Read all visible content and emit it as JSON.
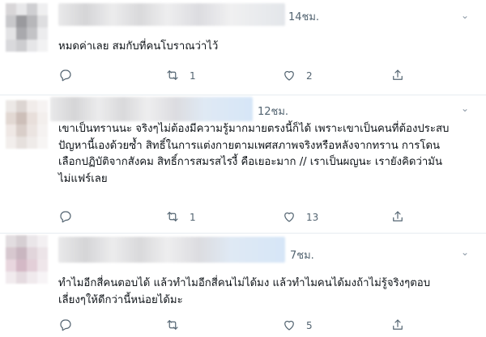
{
  "tweets": [
    {
      "time": "14ชม.",
      "lines": [
        "หมดค่าเลย สมกับที่คนโบราณว่าไว้"
      ],
      "replies": "",
      "retweets": "1",
      "likes": "2"
    },
    {
      "time": "12ชม.",
      "lines": [
        "เขาเป็นทรานนะ จริงๆไม่ต้องมีความรู้มากมายตรงนี้ก็ได้ เพราะเขาเป็นคนที่ต้องประสบ",
        "ปัญหานี้เองด้วยซ้ำ สิทธิ์ในการแต่งกายตามเพศสภาพจริงหรือหลังจากทราน การโดน",
        "เลือกปฏิบัติจากสังคม สิทธิ์การสมรสไรงี้ คือเยอะมาก // เราเป็นผญนะ เรายังคิดว่ามัน",
        "ไม่แฟร์เลย"
      ],
      "replies": "",
      "retweets": "1",
      "likes": "13"
    },
    {
      "time": "7ชม.",
      "lines": [
        "ทำไมอีกสี่คนตอบได้ แล้วทำไมอีกสี่คนไม่ได้มง แล้วทำไมคนได้มงถ้าไม่รู้จริงๆตอบ",
        "เลี่ยงๆให้ดีกว่านี้หน่อยได้มะ"
      ],
      "replies": "",
      "retweets": "",
      "likes": "5"
    }
  ],
  "icons": {
    "reply": "reply-icon",
    "retweet": "retweet-icon",
    "like": "like-icon",
    "share": "share-icon",
    "more": "more-icon"
  },
  "colors": {
    "text": "#0f1419",
    "secondary": "#536471",
    "divider": "#e6ecf0"
  }
}
